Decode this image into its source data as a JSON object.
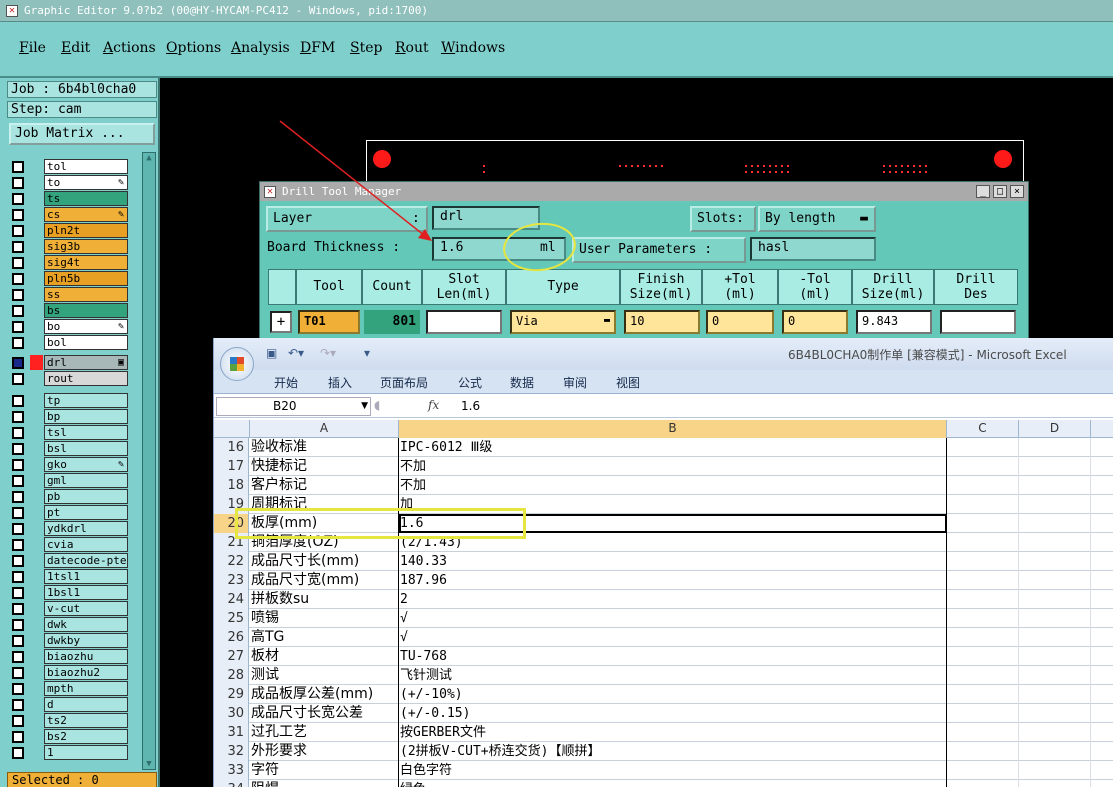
{
  "app": {
    "title": "Graphic Editor 9.0?b2 (00@HY-HYCAM-PC412 - Windows, pid:1700)"
  },
  "menu": [
    "File",
    "Edit",
    "Actions",
    "Options",
    "Analysis",
    "DFM",
    "Step",
    "Rout",
    "Windows"
  ],
  "left": {
    "job": "Job : 6b4bl0cha0",
    "step": "Step: cam",
    "job_matrix": "Job Matrix ...",
    "selected": "Selected : 0",
    "layers": [
      {
        "name": "tol",
        "color": "#ffffff",
        "mark": ""
      },
      {
        "name": "to",
        "color": "#ffffff",
        "mark": "✎"
      },
      {
        "name": "ts",
        "color": "#33a37e",
        "mark": ""
      },
      {
        "name": "cs",
        "color": "#f0b038",
        "mark": "✎"
      },
      {
        "name": "pln2t",
        "color": "#e8a024",
        "mark": ""
      },
      {
        "name": "sig3b",
        "color": "#f0b038",
        "mark": ""
      },
      {
        "name": "sig4t",
        "color": "#f0b038",
        "mark": ""
      },
      {
        "name": "pln5b",
        "color": "#e8a024",
        "mark": ""
      },
      {
        "name": "ss",
        "color": "#f0b038",
        "mark": ""
      },
      {
        "name": "bs",
        "color": "#33a37e",
        "mark": ""
      },
      {
        "name": "bo",
        "color": "#ffffff",
        "mark": "✎"
      },
      {
        "name": "bol",
        "color": "#ffffff",
        "mark": ""
      }
    ],
    "drill_layers": [
      {
        "name": "drl",
        "color": "#a8b8b8",
        "mark": "▣"
      },
      {
        "name": "rout",
        "color": "#d8d8d8",
        "mark": ""
      }
    ],
    "misc_layers": [
      {
        "name": "tp",
        "mark": ""
      },
      {
        "name": "bp",
        "mark": ""
      },
      {
        "name": "tsl",
        "mark": ""
      },
      {
        "name": "bsl",
        "mark": ""
      },
      {
        "name": "gko",
        "mark": "✎"
      },
      {
        "name": "gml",
        "mark": ""
      },
      {
        "name": "pb",
        "mark": ""
      },
      {
        "name": "pt",
        "mark": ""
      },
      {
        "name": "ydkdrl",
        "mark": ""
      },
      {
        "name": "cvia",
        "mark": ""
      },
      {
        "name": "datecode-pte",
        "mark": ""
      },
      {
        "name": "1tsl1",
        "mark": ""
      },
      {
        "name": "1bsl1",
        "mark": ""
      },
      {
        "name": "v-cut",
        "mark": ""
      },
      {
        "name": "dwk",
        "mark": ""
      },
      {
        "name": "dwkby",
        "mark": ""
      },
      {
        "name": "biaozhu",
        "mark": ""
      },
      {
        "name": "biaozhu2",
        "mark": ""
      },
      {
        "name": "mpth",
        "mark": ""
      },
      {
        "name": "d",
        "mark": ""
      },
      {
        "name": "ts2",
        "mark": ""
      },
      {
        "name": "bs2",
        "mark": ""
      },
      {
        "name": "1",
        "mark": ""
      }
    ]
  },
  "dtm": {
    "title": "Drill Tool Manager",
    "layer_label": "Layer",
    "layer_colon": ":",
    "layer_value": "drl",
    "slots_label": "Slots:",
    "slots_value": "By length",
    "thickness_label": "Board Thickness :",
    "thickness_value": "1.6",
    "thickness_unit": "ml",
    "user_params_label": "User Parameters :",
    "user_params_value": "hasl",
    "headers": [
      "Tool",
      "Count",
      "Slot\nLen(ml)",
      "Type",
      "Finish\nSize(ml)",
      "+Tol\n(ml)",
      "-Tol\n(ml)",
      "Drill\nSize(ml)",
      "Drill\nDes"
    ],
    "row": {
      "tool": "T01",
      "count": "801",
      "type": "Via",
      "finish": "10",
      "ptol": "0",
      "mtol": "0",
      "drill": "9.843"
    }
  },
  "excel": {
    "title": "6B4BL0CHA0制作单  [兼容模式] - Microsoft Excel",
    "tabs": [
      "开始",
      "插入",
      "页面布局",
      "公式",
      "数据",
      "审阅",
      "视图"
    ],
    "namebox": "B20",
    "fx": "fx",
    "formula": "1.6",
    "columns": [
      "A",
      "B",
      "C",
      "D"
    ],
    "rows": [
      {
        "n": "16",
        "a": "验收标准",
        "b": "IPC-6012 Ⅲ级"
      },
      {
        "n": "17",
        "a": "快捷标记",
        "b": "不加"
      },
      {
        "n": "18",
        "a": "客户标记",
        "b": "不加"
      },
      {
        "n": "19",
        "a": "周期标记",
        "b": "加"
      },
      {
        "n": "20",
        "a": "板厚(mm)",
        "b": "1.6"
      },
      {
        "n": "21",
        "a": "铜箔厚度(OZ)",
        "b": "(2/1.43)"
      },
      {
        "n": "22",
        "a": "成品尺寸长(mm)",
        "b": "140.33"
      },
      {
        "n": "23",
        "a": "成品尺寸宽(mm)",
        "b": "187.96"
      },
      {
        "n": "24",
        "a": "拼板数su",
        "b": "2"
      },
      {
        "n": "25",
        "a": "喷锡",
        "b": "√"
      },
      {
        "n": "26",
        "a": "高TG",
        "b": "√"
      },
      {
        "n": "27",
        "a": "板材",
        "b": "TU-768"
      },
      {
        "n": "28",
        "a": "测试",
        "b": "飞针测试"
      },
      {
        "n": "29",
        "a": "成品板厚公差(mm)",
        "b": "(+/-10%)"
      },
      {
        "n": "30",
        "a": "成品尺寸长宽公差",
        "b": "(+/-0.15)"
      },
      {
        "n": "31",
        "a": "过孔工艺",
        "b": "按GERBER文件"
      },
      {
        "n": "32",
        "a": "外形要求",
        "b": "(2拼板V-CUT+桥连交货)【顺拼】"
      },
      {
        "n": "33",
        "a": "字符",
        "b": "白色字符"
      },
      {
        "n": "34",
        "a": "阻焊",
        "b": "绿色"
      }
    ]
  }
}
